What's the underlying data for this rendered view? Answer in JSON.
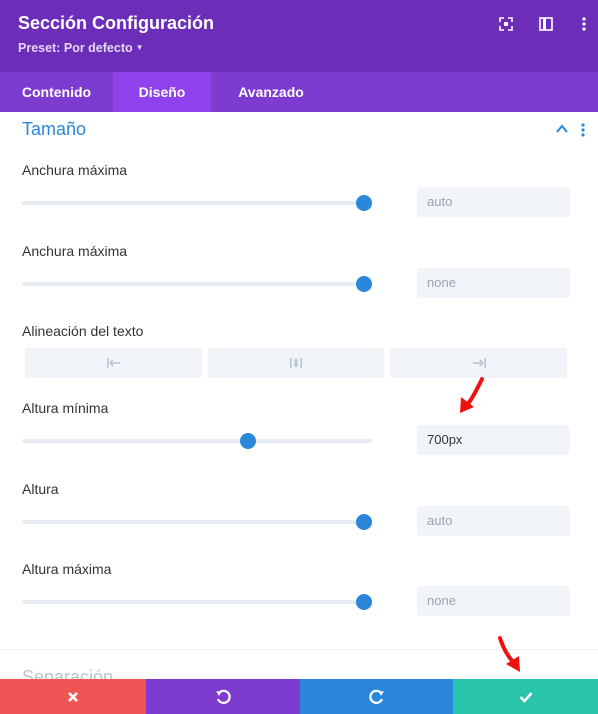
{
  "header": {
    "title": "Sección Configuración",
    "preset": "Preset: Por defecto",
    "bg_color": "#6c2eb9"
  },
  "tabs": [
    {
      "label": "Contenido",
      "active": false
    },
    {
      "label": "Diseño",
      "active": true
    },
    {
      "label": "Avanzado",
      "active": false
    }
  ],
  "section": {
    "title": "Tamaño",
    "accent_color": "#2b87da",
    "settings": {
      "max_width_1": {
        "label": "Anchura máxima",
        "value": "auto",
        "slider_level": 1.0
      },
      "max_width_2": {
        "label": "Anchura máxima",
        "value": "none",
        "slider_level": 1.0
      },
      "text_align": {
        "label": "Alineación del texto",
        "options": [
          "left",
          "center",
          "right"
        ]
      },
      "min_height": {
        "label": "Altura mínima",
        "value": "700px",
        "slider_level": 0.66
      },
      "height": {
        "label": "Altura",
        "value": "auto",
        "slider_level": 1.0
      },
      "max_height": {
        "label": "Altura máxima",
        "value": "none",
        "slider_level": 1.0
      }
    }
  },
  "next_section": {
    "title": "Separación"
  },
  "footer": {
    "buttons": [
      {
        "name": "cancel",
        "icon": "close-icon",
        "color": "#ef5555"
      },
      {
        "name": "undo",
        "icon": "undo-icon",
        "color": "#7e3bd0"
      },
      {
        "name": "redo",
        "icon": "redo-icon",
        "color": "#2b87da"
      },
      {
        "name": "save",
        "icon": "check-icon",
        "color": "#29c4a9"
      }
    ]
  },
  "annotation_color": "#ee1111"
}
